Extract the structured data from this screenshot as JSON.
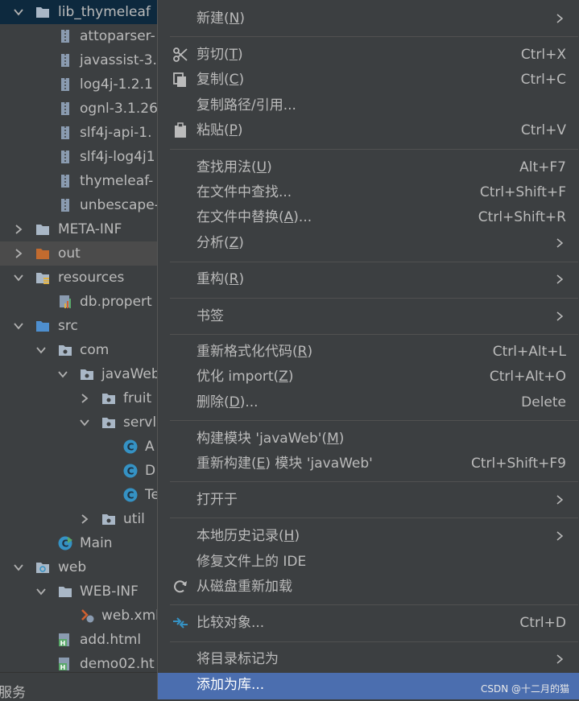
{
  "tree": {
    "items": [
      {
        "label": "lib_thymeleaf",
        "icon": "folder-icon",
        "expanded": true
      },
      {
        "label": "attoparser-",
        "icon": "jar-icon"
      },
      {
        "label": "javassist-3.",
        "icon": "jar-icon"
      },
      {
        "label": "log4j-1.2.1",
        "icon": "jar-icon"
      },
      {
        "label": "ognl-3.1.26",
        "icon": "jar-icon"
      },
      {
        "label": "slf4j-api-1.",
        "icon": "jar-icon"
      },
      {
        "label": "slf4j-log4j1",
        "icon": "jar-icon"
      },
      {
        "label": "thymeleaf-",
        "icon": "jar-icon"
      },
      {
        "label": "unbescape-",
        "icon": "jar-icon"
      },
      {
        "label": "META-INF",
        "icon": "folder-icon",
        "expanded": false
      },
      {
        "label": "out",
        "icon": "excluded-folder-icon",
        "expanded": false
      },
      {
        "label": "resources",
        "icon": "resources-folder-icon",
        "expanded": true
      },
      {
        "label": "db.propert",
        "icon": "properties-file-icon"
      },
      {
        "label": "src",
        "icon": "source-folder-icon",
        "expanded": true
      },
      {
        "label": "com",
        "icon": "package-icon",
        "expanded": true
      },
      {
        "label": "javaWeb",
        "icon": "package-icon",
        "expanded": true
      },
      {
        "label": "fruit",
        "icon": "package-icon",
        "expanded": false
      },
      {
        "label": "servle",
        "icon": "package-icon",
        "expanded": true
      },
      {
        "label": "A",
        "icon": "class-icon"
      },
      {
        "label": "D",
        "icon": "class-icon"
      },
      {
        "label": "Te",
        "icon": "class-icon"
      },
      {
        "label": "util",
        "icon": "package-icon",
        "expanded": false
      },
      {
        "label": "Main",
        "icon": "main-class-icon"
      },
      {
        "label": "web",
        "icon": "web-folder-icon",
        "expanded": true
      },
      {
        "label": "WEB-INF",
        "icon": "folder-icon",
        "expanded": true
      },
      {
        "label": "web.xml",
        "icon": "xml-file-icon"
      },
      {
        "label": "add.html",
        "icon": "html-file-icon"
      },
      {
        "label": "demo02.ht",
        "icon": "html-file-icon"
      }
    ],
    "status_text": "服务"
  },
  "menu": {
    "items": [
      {
        "label": "新建(",
        "mn": "N",
        "tail": ")",
        "shortcut": "",
        "submenu": true
      },
      {
        "label": "剪切(",
        "mn": "T",
        "tail": ")",
        "shortcut": "Ctrl+X",
        "icon": "scissors-icon"
      },
      {
        "label": "复制(",
        "mn": "C",
        "tail": ")",
        "shortcut": "Ctrl+C",
        "icon": "copy-icon"
      },
      {
        "label": "复制路径/引用...",
        "mn": "",
        "tail": "",
        "shortcut": ""
      },
      {
        "label": "粘贴(",
        "mn": "P",
        "tail": ")",
        "shortcut": "Ctrl+V",
        "icon": "paste-icon"
      },
      {
        "label": "查找用法(",
        "mn": "U",
        "tail": ")",
        "shortcut": "Alt+F7"
      },
      {
        "label": "在文件中查找...",
        "mn": "",
        "tail": "",
        "shortcut": "Ctrl+Shift+F"
      },
      {
        "label": "在文件中替换(",
        "mn": "A",
        "tail": ")...",
        "shortcut": "Ctrl+Shift+R"
      },
      {
        "label": "分析(",
        "mn": "Z",
        "tail": ")",
        "shortcut": "",
        "submenu": true
      },
      {
        "label": "重构(",
        "mn": "R",
        "tail": ")",
        "shortcut": "",
        "submenu": true
      },
      {
        "label": "书签",
        "mn": "",
        "tail": "",
        "shortcut": "",
        "submenu": true
      },
      {
        "label": "重新格式化代码(",
        "mn": "R",
        "tail": ")",
        "shortcut": "Ctrl+Alt+L"
      },
      {
        "label": "优化 import(",
        "mn": "Z",
        "tail": ")",
        "shortcut": "Ctrl+Alt+O"
      },
      {
        "label": "删除(",
        "mn": "D",
        "tail": ")...",
        "shortcut": "Delete"
      },
      {
        "label": "构建模块 'javaWeb'(",
        "mn": "M",
        "tail": ")",
        "shortcut": ""
      },
      {
        "label": "重新构建(",
        "mn": "E",
        "tail": ") 模块 'javaWeb'",
        "shortcut": "Ctrl+Shift+F9"
      },
      {
        "label": "打开于",
        "mn": "",
        "tail": "",
        "shortcut": "",
        "submenu": true
      },
      {
        "label": "本地历史记录(",
        "mn": "H",
        "tail": ")",
        "shortcut": "",
        "submenu": true
      },
      {
        "label": "修复文件上的 IDE",
        "mn": "",
        "tail": "",
        "shortcut": ""
      },
      {
        "label": "从磁盘重新加载",
        "mn": "",
        "tail": "",
        "shortcut": "",
        "icon": "reload-icon"
      },
      {
        "label": "比较对象...",
        "mn": "",
        "tail": "",
        "shortcut": "Ctrl+D",
        "icon": "compare-icon"
      },
      {
        "label": "将目录标记为",
        "mn": "",
        "tail": "",
        "shortcut": "",
        "submenu": true
      },
      {
        "label": "添加为库...",
        "mn": "",
        "tail": "",
        "shortcut": "",
        "highlighted": true
      }
    ],
    "watermark": "CSDN @十二月的猫"
  },
  "colors": {
    "background": "#3c3f41",
    "text": "#bbbbbb",
    "selection_dark": "#0d293e",
    "highlight": "#4b6eaf",
    "separator": "#515151",
    "folder": "#a9b7c6",
    "excluded_folder": "#c26b2f",
    "source_folder": "#4e8fcf",
    "class_icon": "#3592c4"
  }
}
